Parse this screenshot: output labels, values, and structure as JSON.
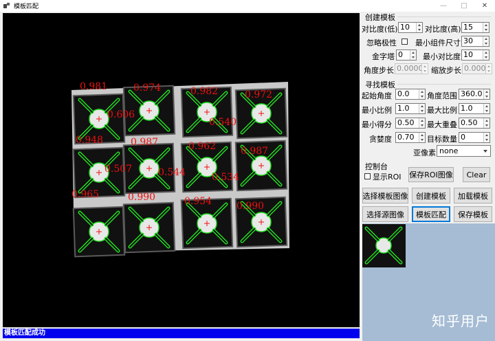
{
  "window": {
    "title": "模板匹配",
    "minimize": "—",
    "maximize": "□",
    "close": "✕"
  },
  "status": "模板匹配成功",
  "create_group": {
    "title": "创建模板",
    "contrast_low_label": "对比度(低)",
    "contrast_low": "10",
    "contrast_high_label": "对比度(高)",
    "contrast_high": "15",
    "ignore_polarity_label": "忽略极性",
    "min_component_label": "最小组件尺寸",
    "min_component": "30",
    "pyramid_label": "金字塔",
    "pyramid": "0",
    "min_contrast_label": "最小对比度",
    "min_contrast": "10",
    "angle_step_label": "角度步长",
    "angle_step": "0.0000",
    "scale_step_label": "缩放步长",
    "scale_step": "0.0000"
  },
  "find_group": {
    "title": "寻找模板",
    "start_angle_label": "起始角度",
    "start_angle": "0.0",
    "angle_range_label": "角度范围",
    "angle_range": "360.0",
    "min_scale_label": "最小比例",
    "min_scale": "1.0",
    "max_scale_label": "最大比例",
    "max_scale": "1.0",
    "min_score_label": "最小得分",
    "min_score": "0.50",
    "max_overlap_label": "最大重叠",
    "max_overlap": "0.50",
    "greediness_label": "贪婪度",
    "greediness": "0.70",
    "num_matches_label": "目标数量",
    "num_matches": "0",
    "subpixel_label": "亚像素",
    "subpixel": "none"
  },
  "console_group": {
    "title": "控制台",
    "show_roi_label": "显示ROI",
    "save_roi_button": "保存ROI图像",
    "clear_button": "Clear"
  },
  "buttons": {
    "select_template_image": "选择模板图像",
    "create_template": "创建模板",
    "load_template": "加载模板",
    "select_source_image": "选择源图像",
    "template_match": "模板匹配",
    "save_template": "保存模板"
  },
  "watermark": "知乎用户",
  "matches": {
    "row1": [
      "0.981",
      "0.974",
      "0.982",
      "0.972"
    ],
    "row1_extra": "0.606",
    "row1_extra2": "0.540",
    "row2": [
      "0.948",
      "0.987",
      "0.962",
      "0.987"
    ],
    "row2_extra": "0.507",
    "row2_extra2": "0.544",
    "row2_extra3": "0.534",
    "row3": [
      "0.965",
      "0.990",
      "0.954",
      "0.990"
    ]
  },
  "colors": {
    "status_bar": "#0000ee",
    "match_outline": "#22dd22",
    "score_text": "#ee1111",
    "thumb_bg": "#a5bcd4"
  }
}
